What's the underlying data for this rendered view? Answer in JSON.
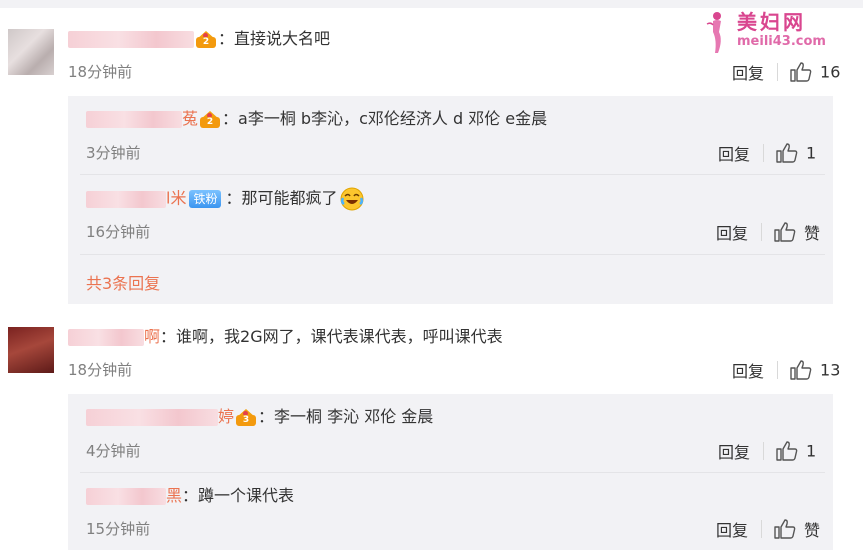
{
  "watermark": {
    "cn": "美妇网",
    "url": "meili43.com"
  },
  "comments": [
    {
      "user_suffix": "",
      "badge": "crown",
      "badge_level": "2",
      "text": "直接说大名吧",
      "time": "18分钟前",
      "reply_label": "回复",
      "likes": "16",
      "replies": [
        {
          "user_suffix": "菟",
          "badge": "crown",
          "badge_level": "2",
          "text": "a李一桐 b李沁，c邓伦经济人 d 邓伦  e金晨",
          "time": "3分钟前",
          "reply_label": "回复",
          "likes": "1"
        },
        {
          "user_suffix": "l米",
          "badge": "fan",
          "badge_text": "铁粉",
          "text": "那可能都疯了",
          "emoji": "laugh-cry-emoji",
          "time": "16分钟前",
          "reply_label": "回复",
          "likes": "赞"
        }
      ],
      "more_replies": "共3条回复"
    },
    {
      "user_suffix": "啊",
      "text": "谁啊，我2G网了，课代表课代表，呼叫课代表",
      "time": "18分钟前",
      "reply_label": "回复",
      "likes": "13",
      "replies": [
        {
          "user_suffix": "婷",
          "badge": "crown",
          "badge_level": "3",
          "text": "李一桐 李沁 邓伦 金晨",
          "time": "4分钟前",
          "reply_label": "回复",
          "likes": "1"
        },
        {
          "user_suffix": "黑",
          "text": "蹲一个课代表",
          "time": "15分钟前",
          "reply_label": "回复",
          "likes": "赞"
        }
      ]
    }
  ],
  "colors": {
    "username": "#eb7350",
    "reply_bg": "#f2f2f5",
    "time": "#808080",
    "fan_badge": "#3b95f0",
    "crown": "#f39a0e"
  },
  "icons": [
    "thumb-up-icon",
    "crown-badge-icon",
    "fan-badge",
    "laugh-cry-emoji"
  ]
}
